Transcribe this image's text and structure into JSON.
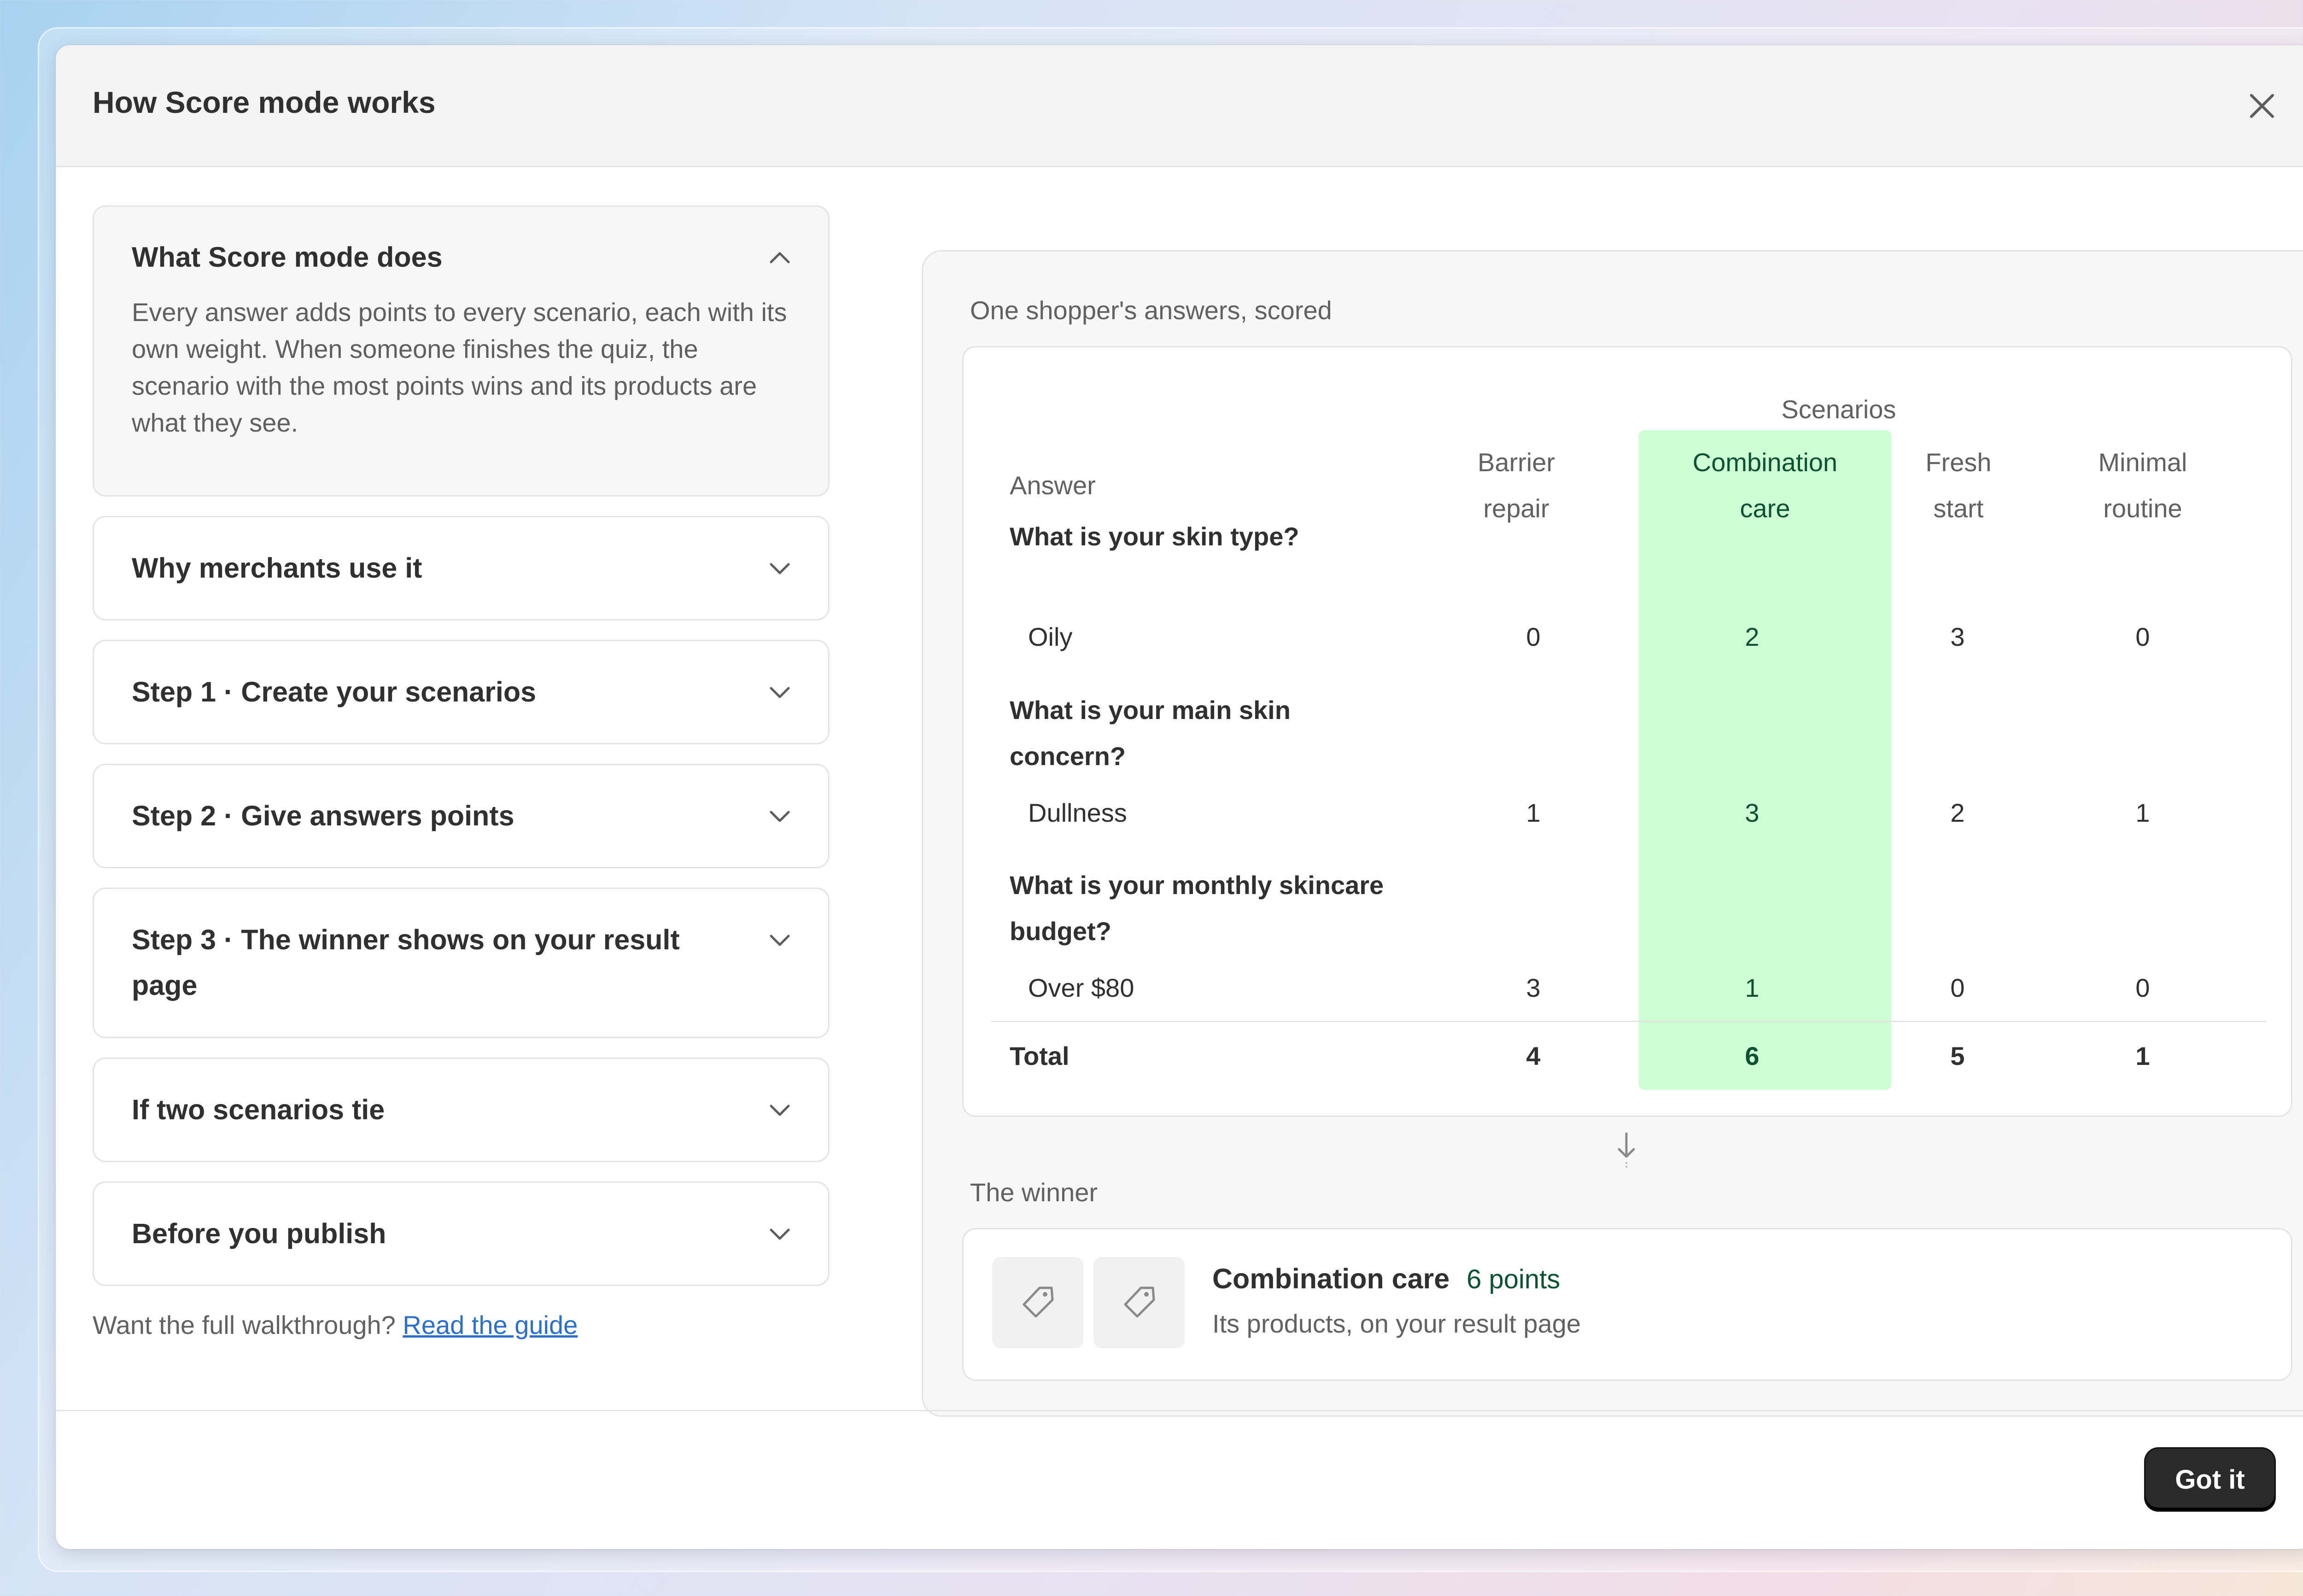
{
  "modal": {
    "title": "How Score mode works",
    "close_label": "close"
  },
  "accordion": [
    {
      "title": "What Score mode does",
      "open": true,
      "body": "Every answer adds points to every scenario, each with its own weight. When someone finishes the quiz, the scenario with the most points wins and its products are what they see."
    },
    {
      "title": "Why merchants use it",
      "open": false
    },
    {
      "title": "Step 1 · Create your scenarios",
      "open": false
    },
    {
      "title": "Step 2 · Give answers points",
      "open": false
    },
    {
      "title": "Step 3 · The winner shows on your result page",
      "open": false
    },
    {
      "title": "If two scenarios tie",
      "open": false
    },
    {
      "title": "Before you publish",
      "open": false
    }
  ],
  "footer": {
    "prompt": "Want the full walkthrough?",
    "link": "Read the guide"
  },
  "example": {
    "label": "One shopper's answers, scored",
    "table": {
      "scenarios_label": "Scenarios",
      "answer_label": "Answer",
      "columns": [
        {
          "line1": "Barrier",
          "line2": "repair"
        },
        {
          "line1": "Combination",
          "line2": "care"
        },
        {
          "line1": "Fresh",
          "line2": "start"
        },
        {
          "line1": "Minimal",
          "line2": "routine"
        }
      ],
      "highlight_color": "#cdfed4",
      "questions": [
        {
          "q_line1": "What is your skin type?",
          "q_line2": "",
          "answer": "Oily",
          "scores": [
            "0",
            "2",
            "3",
            "0"
          ]
        },
        {
          "q_line1": "What is your main skin",
          "q_line2": "concern?",
          "answer": "Dullness",
          "scores": [
            "1",
            "3",
            "2",
            "1"
          ]
        },
        {
          "q_line1": "What is your monthly skincare",
          "q_line2": "budget?",
          "answer": "Over $80",
          "scores": [
            "3",
            "1",
            "0",
            "0"
          ]
        }
      ],
      "total_label": "Total",
      "totals": [
        "4",
        "6",
        "5",
        "1"
      ]
    }
  },
  "winner": {
    "label": "The winner",
    "name": "Combination care",
    "points": "6 points",
    "description": "Its products, on your result page",
    "icons": [
      "tag-icon",
      "tag-icon"
    ]
  },
  "buttons": {
    "got_it": "Got it"
  }
}
